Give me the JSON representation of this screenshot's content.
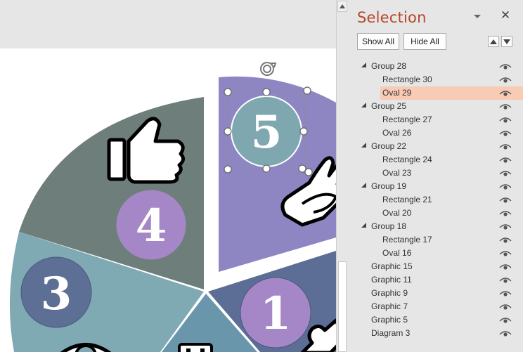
{
  "slide": {
    "segments": [
      {
        "number": "1",
        "icon": "puzzle-icon"
      },
      {
        "number": "3",
        "icon": "eye-icon"
      },
      {
        "number": "4",
        "icon": "thumbs-up-icon"
      },
      {
        "number": "5",
        "icon": "sign-language-hands-icon"
      }
    ],
    "colors": {
      "segment_1": "#5c6d96",
      "segment_2": "#6996ab",
      "segment_3": "#7fa9b3",
      "segment_4": "#6e7f7b",
      "segment_5": "#8e85c3",
      "oval_5": "#7ea7b0",
      "oval_4": "#a587c7",
      "oval_3": "#5e6f96",
      "oval_1": "#a587c7"
    }
  },
  "pane": {
    "title": "Selection",
    "show_all_label": "Show All",
    "hide_all_label": "Hide All",
    "items": [
      {
        "label": "Group 28",
        "level": 0,
        "expander": true,
        "selected": false
      },
      {
        "label": "Rectangle 30",
        "level": 1,
        "expander": false,
        "selected": false
      },
      {
        "label": "Oval 29",
        "level": 1,
        "expander": false,
        "selected": true
      },
      {
        "label": "Group 25",
        "level": 0,
        "expander": true,
        "selected": false
      },
      {
        "label": "Rectangle 27",
        "level": 1,
        "expander": false,
        "selected": false
      },
      {
        "label": "Oval 26",
        "level": 1,
        "expander": false,
        "selected": false
      },
      {
        "label": "Group 22",
        "level": 0,
        "expander": true,
        "selected": false
      },
      {
        "label": "Rectangle 24",
        "level": 1,
        "expander": false,
        "selected": false
      },
      {
        "label": "Oval 23",
        "level": 1,
        "expander": false,
        "selected": false
      },
      {
        "label": "Group 19",
        "level": 0,
        "expander": true,
        "selected": false
      },
      {
        "label": "Rectangle 21",
        "level": 1,
        "expander": false,
        "selected": false
      },
      {
        "label": "Oval 20",
        "level": 1,
        "expander": false,
        "selected": false
      },
      {
        "label": "Group 18",
        "level": 0,
        "expander": true,
        "selected": false
      },
      {
        "label": "Rectangle 17",
        "level": 1,
        "expander": false,
        "selected": false
      },
      {
        "label": "Oval 16",
        "level": 1,
        "expander": false,
        "selected": false
      },
      {
        "label": "Graphic 15",
        "level": 0,
        "expander": false,
        "selected": false
      },
      {
        "label": "Graphic 11",
        "level": 0,
        "expander": false,
        "selected": false
      },
      {
        "label": "Graphic 9",
        "level": 0,
        "expander": false,
        "selected": false
      },
      {
        "label": "Graphic 7",
        "level": 0,
        "expander": false,
        "selected": false
      },
      {
        "label": "Graphic 5",
        "level": 0,
        "expander": false,
        "selected": false
      },
      {
        "label": "Diagram 3",
        "level": 0,
        "expander": false,
        "selected": false
      }
    ],
    "accent": "#b7472a",
    "selected_bg": "#f8cbb4"
  }
}
